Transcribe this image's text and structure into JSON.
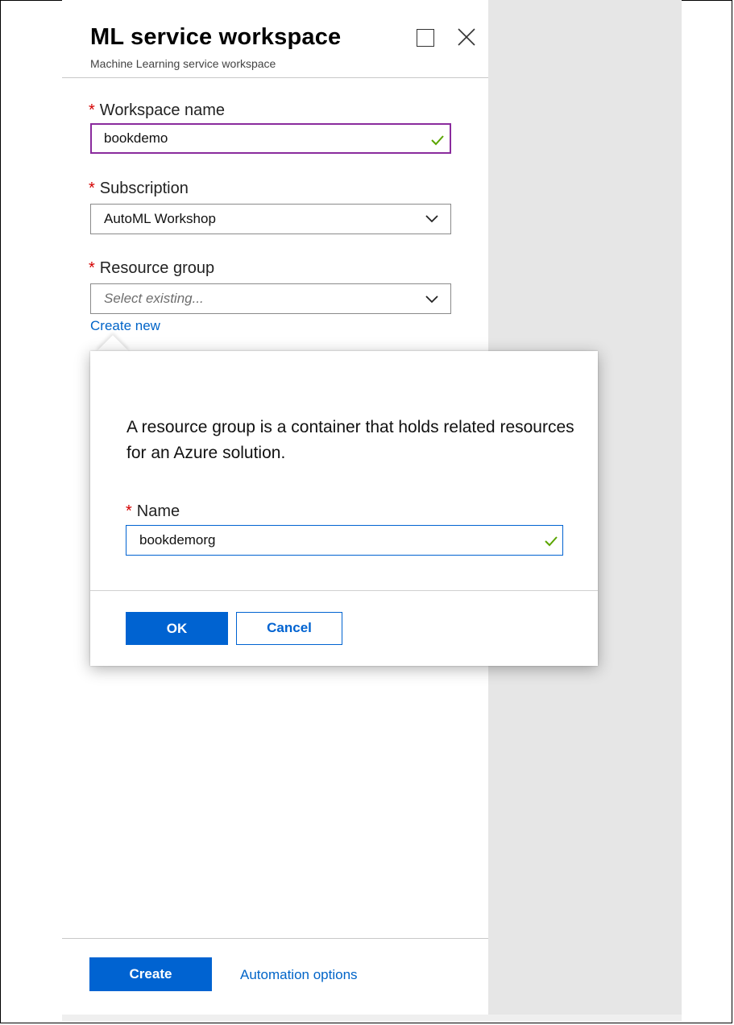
{
  "blade": {
    "title": "ML service workspace",
    "subtitle": "Machine Learning service workspace",
    "maximize_icon": "maximize-icon",
    "close_icon": "close-icon"
  },
  "form": {
    "workspace_name": {
      "required_mark": "*",
      "label": "Workspace name",
      "value": "bookdemo",
      "status_icon": "check-icon"
    },
    "subscription": {
      "required_mark": "*",
      "label": "Subscription",
      "value": "AutoML Workshop",
      "dropdown_icon": "chevron-down-icon"
    },
    "resource_group": {
      "required_mark": "*",
      "label": "Resource group",
      "placeholder": "Select existing...",
      "dropdown_icon": "chevron-down-icon",
      "create_new_link": "Create new"
    }
  },
  "popup": {
    "description": "A resource group is a container that holds related resources for an Azure solution.",
    "name_field": {
      "required_mark": "*",
      "label": "Name",
      "value": "bookdemorg",
      "status_icon": "check-icon"
    },
    "ok_label": "OK",
    "cancel_label": "Cancel"
  },
  "footer": {
    "create_label": "Create",
    "automation_label": "Automation options"
  },
  "colors": {
    "accent": "#0063d1",
    "required": "#d40000",
    "valid_check": "#5aa500",
    "focus_purple": "#8a2b9d",
    "side_gray": "#e6e6e6"
  }
}
